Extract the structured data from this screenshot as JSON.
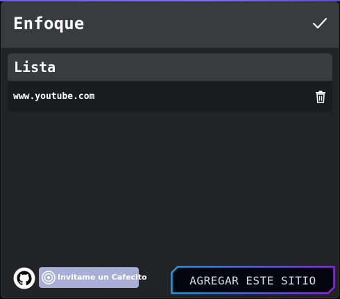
{
  "header": {
    "title": "Enfoque",
    "confirm_icon": "check-icon"
  },
  "list": {
    "title": "Lista",
    "items": [
      {
        "url": "www.youtube.com",
        "delete_icon": "trash-icon"
      }
    ]
  },
  "footer": {
    "github_icon": "github-icon",
    "cafecito_label": "Invitame un Cafecito",
    "add_button_label": "AGREGAR ESTE SITIO"
  },
  "colors": {
    "panel_bg": "#222326",
    "header_bg": "#3a3b3e",
    "row_bg": "#1b1c1e",
    "cafecito_bg": "#a9aed6",
    "button_border_start": "#1f9fd8",
    "button_border_end": "#8a2be2"
  }
}
